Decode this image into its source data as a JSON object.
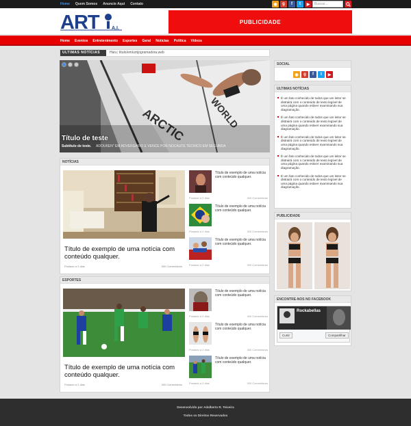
{
  "top_nav": {
    "items": [
      "Home",
      "Quem Somos",
      "Anuncie Aqui",
      "Contato"
    ]
  },
  "search": {
    "placeholder": "Buscar..."
  },
  "social_icons": [
    {
      "icon": "rss-icon",
      "color": "#f4a11a",
      "glyph": "r"
    },
    {
      "icon": "google-plus-icon",
      "color": "#d23e2b",
      "glyph": "g"
    },
    {
      "icon": "facebook-icon",
      "color": "#3b5998",
      "glyph": "f"
    },
    {
      "icon": "twitter-icon",
      "color": "#1da1f2",
      "glyph": "t"
    },
    {
      "icon": "youtube-icon",
      "color": "#cc181e",
      "glyph": "y"
    }
  ],
  "logo": {
    "text": "ART",
    "suffix": "A.I."
  },
  "ad": {
    "label": "PUBLICIDADE"
  },
  "main_nav": {
    "items": [
      "Home",
      "Eventos",
      "Entretenimento",
      "Esportes",
      "Geral",
      "Notícias",
      "Política",
      "Vídeos"
    ]
  },
  "ticker": {
    "label": "ULTIMAS NOTÍCIAS",
    "text": "Haru; título/em/umjogramadora.web"
  },
  "slider": {
    "title": "Título de teste",
    "subtitle": "Subtítulo de teste.",
    "overlay": "ADOUKEN\" EM ADVERSÁRIO E VENCE POR NOCAUTE TÉCNICO EM SEGUNDA"
  },
  "news_section": {
    "heading": "NOTÍCIAS",
    "big_title": "Título de exemplo de uma notícia com conteúdo qualquer.",
    "big_meta_left": "Postado a 2 dias",
    "big_meta_right": "300 Comentários",
    "items": [
      {
        "title": "Título de exemplo de uma notícia com conteúdo qualquer.",
        "meta_left": "Postado a 2 dias",
        "meta_right": "300 Comentários"
      },
      {
        "title": "Título de exemplo de uma notícia com conteúdo qualquer.",
        "meta_left": "Postado a 2 dias",
        "meta_right": "300 Comentários"
      },
      {
        "title": "Título de exemplo de uma notícia com conteúdo qualquer.",
        "meta_left": "Postado a 2 dias",
        "meta_right": "300 Comentários"
      }
    ]
  },
  "sports_section": {
    "heading": "ESPORTES",
    "big_title": "Título de exemplo de uma notícia com conteúdo qualquer.",
    "big_meta_left": "Postado a 2 dias",
    "big_meta_right": "300 Comentários",
    "items": [
      {
        "title": "Título de exemplo de uma notícia com conteúdo qualquer.",
        "meta_left": "Postado a 2 dias",
        "meta_right": "300 Comentários"
      },
      {
        "title": "Título de exemplo de uma notícia com conteúdo qualquer.",
        "meta_left": "Postado a 2 dias",
        "meta_right": "300 Comentários"
      },
      {
        "title": "Título de exemplo de uma notícia com conteúdo qualquer.",
        "meta_left": "Postado a 2 dias",
        "meta_right": "300 Comentários"
      }
    ]
  },
  "sidebar": {
    "social_heading": "SOCIAL",
    "latest_heading": "ULTIMAS NOTÍCIAS",
    "latest_items": [
      "É um fato conhecido de todos que um leitor se distrairá com o conteúdo de texto legível de uma página quando estiver examinando sua diagramação.",
      "É um fato conhecido de todos que um leitor se distrairá com o conteúdo de texto legível de uma página quando estiver examinando sua diagramação.",
      "É um fato conhecido de todos que um leitor se distrairá com o conteúdo de texto legível de uma página quando estiver examinando sua diagramação.",
      "É um fato conhecido de todos que um leitor se distrairá com o conteúdo de texto legível de uma página quando estiver examinando sua diagramação.",
      "É um fato conhecido de todos que um leitor se distrairá com o conteúdo de texto legível de uma página quando estiver examinando sua diagramação."
    ],
    "ad_heading": "PUBLICIDADE",
    "fb_heading": "ENCONTRE-NOS NO FACEBOOK",
    "fb_page_name": "Rockabellas",
    "fb_like": "Curtir",
    "fb_share": "Compartilhar"
  },
  "footer": {
    "line1": "Desenvolvido por Adalberto R. Teixeira",
    "line2": "Todos os Direitos Reservados"
  },
  "colors": {
    "brand_red": "#e60000",
    "link_blue": "#4a90e2",
    "footer": "#2e2e2e"
  }
}
